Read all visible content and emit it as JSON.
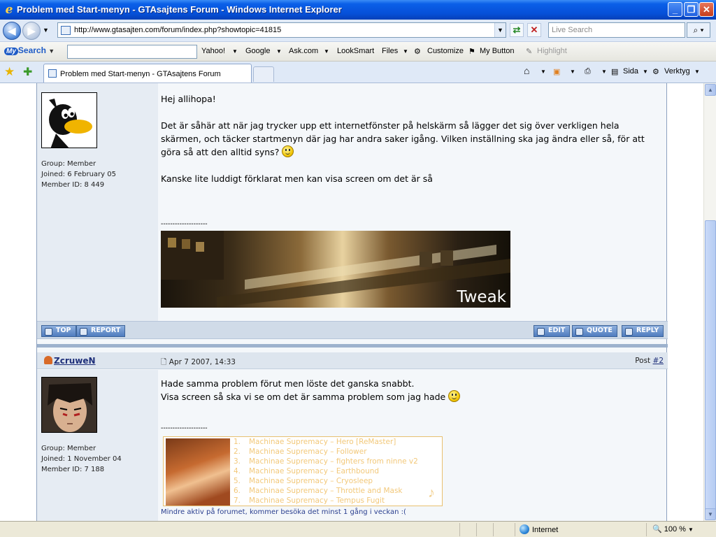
{
  "window": {
    "title": "Problem med Start-menyn - GTAsajtens Forum - Windows Internet Explorer"
  },
  "address": {
    "url": "http://www.gtasajten.com/forum/index.php?showtopic=41815",
    "search_placeholder": "Live Search"
  },
  "toolbar": {
    "brand_my": "My",
    "brand_search": "Search",
    "items": [
      "Yahoo!",
      "Google",
      "Ask.com",
      "LookSmart",
      "Files",
      "Customize",
      "My Button",
      "Highlight"
    ]
  },
  "tabs": {
    "active_label": "Problem med Start-menyn - GTAsajtens Forum"
  },
  "commands": {
    "page": "Sida",
    "tools": "Verktyg"
  },
  "posts": [
    {
      "group": "Group: Member",
      "joined": "Joined: 6 February 05",
      "member_id": "Member ID: 8 449",
      "body": {
        "greeting": "Hej allihopa!",
        "para1": "Det är såhär att när jag trycker upp ett internetfönster på helskärm så lägger det sig över verkligen hela skärmen, och täcker startmenyn där jag har andra saker igång. Vilken inställning ska jag ändra eller så, för att göra så att den alltid syns?",
        "para2": "Kanske lite luddigt förklarat men kan visa screen om det är så"
      },
      "sig_divider": "--------------------",
      "sig_text": "Tweak",
      "buttons": {
        "top": "TOP",
        "report": "REPORT",
        "edit": "EDIT",
        "quote": "QUOTE",
        "reply": "REPLY"
      }
    },
    {
      "username": "ZcruweN",
      "date": "Apr 7 2007, 14:33",
      "post_label": "Post",
      "post_num": "#2",
      "group": "Group: Member",
      "joined": "Joined: 1 November 04",
      "member_id": "Member ID: 7 188",
      "body": {
        "line1": "Hade samma problem förut men löste det ganska snabbt.",
        "line2": "Visa screen så ska vi se om det är samma problem som jag hade"
      },
      "sig_divider": "--------------------",
      "playlist": [
        "Machinae Supremacy – Hero [ReMaster]",
        "Machinae Supremacy – Follower",
        "Machinae Supremacy – fighters from ninne v2",
        "Machinae Supremacy – Earthbound",
        "Machinae Supremacy – Cryosleep",
        "Machinae Supremacy – Throttle and Mask",
        "Machinae Supremacy – Tempus Fugit"
      ],
      "sig_footer": "Mindre aktiv på forumet, kommer besöka det minst 1 gång i veckan :("
    }
  ],
  "status": {
    "zone": "Internet",
    "zoom": "100 %"
  }
}
